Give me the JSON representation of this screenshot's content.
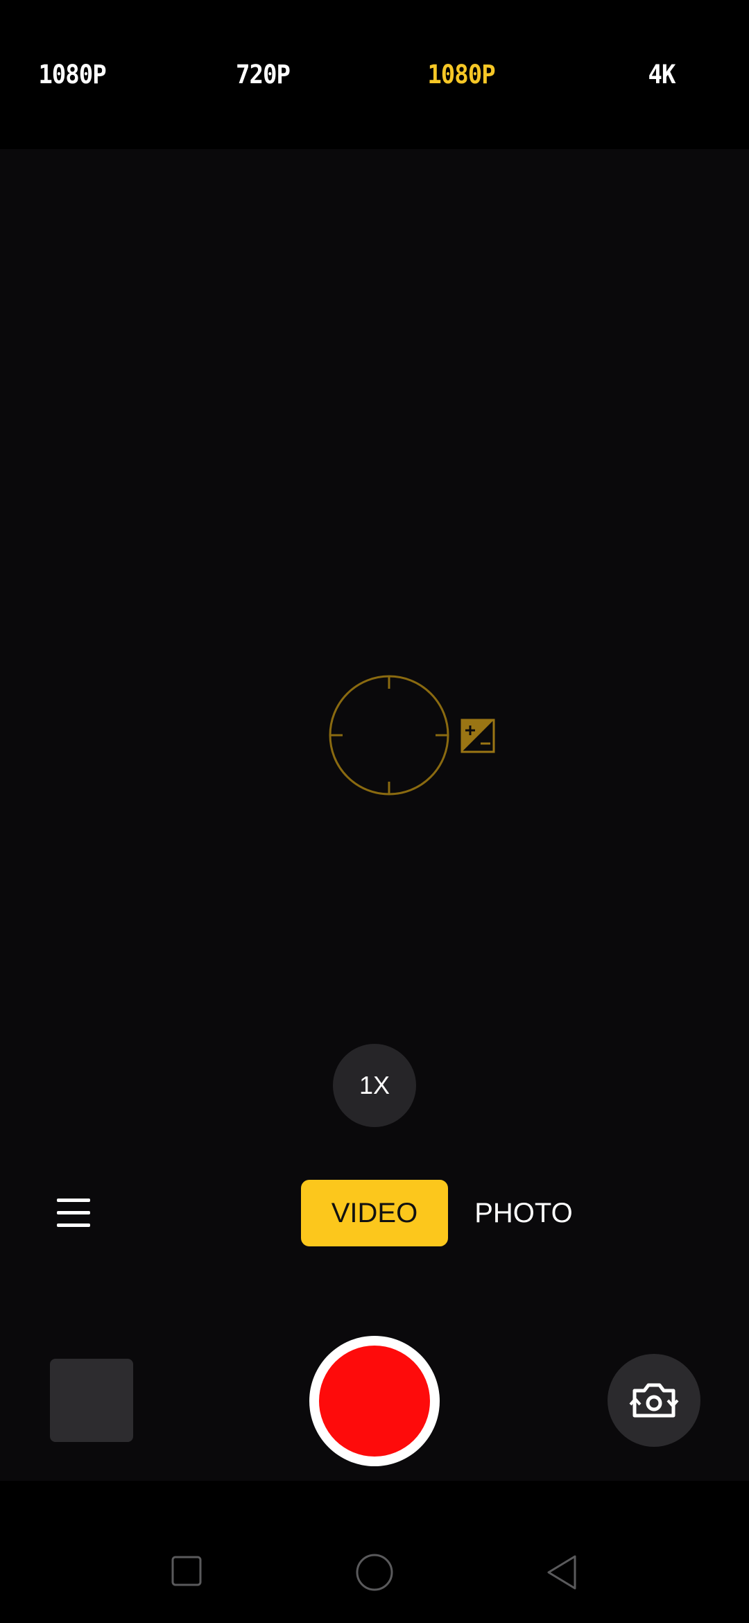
{
  "resolution_bar": {
    "options": [
      {
        "label": "1080P",
        "selected": false
      },
      {
        "label": "720P",
        "selected": false
      },
      {
        "label": "1080P",
        "selected": true
      },
      {
        "label": "4K",
        "selected": false
      }
    ]
  },
  "viewfinder": {
    "focus_icon": "focus-ring-icon",
    "exposure_icon": "exposure-compensation-icon"
  },
  "zoom": {
    "label": "1X"
  },
  "modes": {
    "video_label": "VIDEO",
    "photo_label": "PHOTO",
    "active": "VIDEO"
  },
  "controls": {
    "menu_icon": "hamburger-menu-icon",
    "gallery_icon": "gallery-thumbnail",
    "record_icon": "record-button",
    "switch_camera_icon": "switch-camera-icon"
  },
  "nav_bar": {
    "recents_icon": "recents-square-icon",
    "home_icon": "home-circle-icon",
    "back_icon": "back-triangle-icon"
  },
  "colors": {
    "accent": "#fcc71c",
    "selected_resolution": "#f6c726",
    "record": "#fe0b0b",
    "focus_ring": "#8a6a10"
  }
}
